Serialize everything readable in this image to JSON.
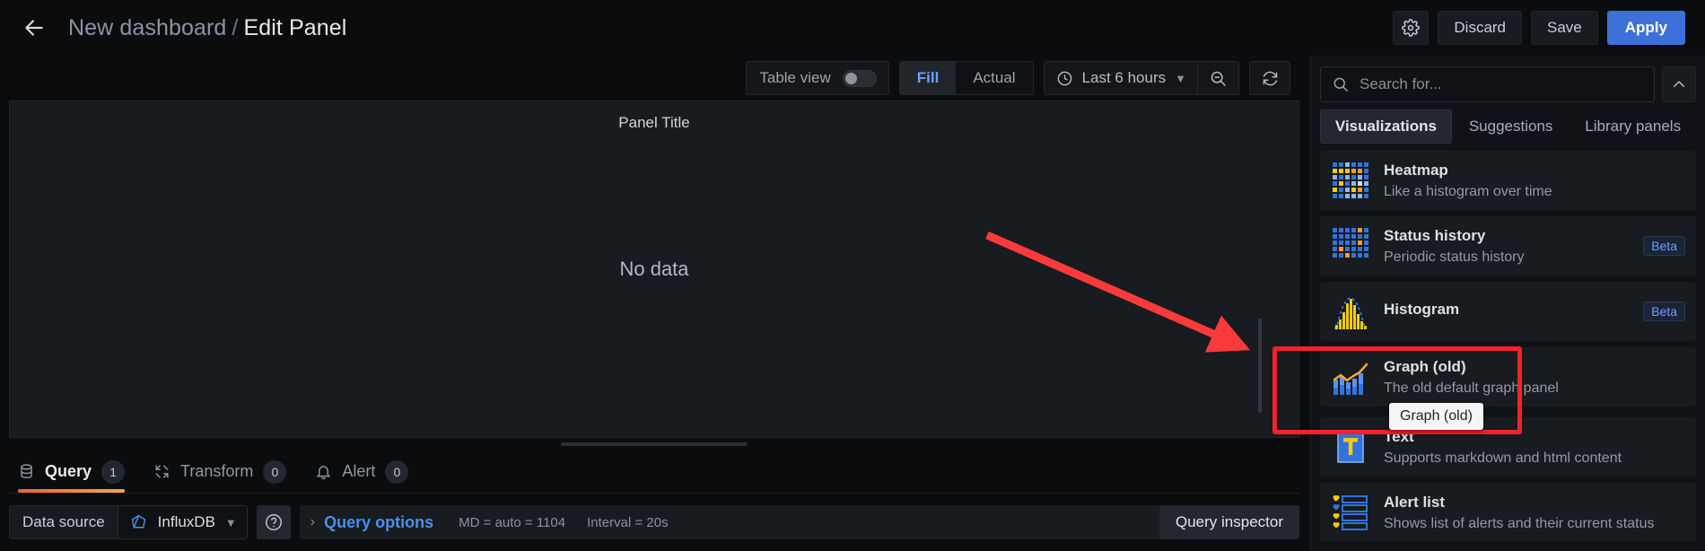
{
  "topbar": {
    "back_icon": "arrow-left-icon",
    "breadcrumb_dashboard": "New dashboard",
    "breadcrumb_separator": "/",
    "breadcrumb_current": "Edit Panel",
    "settings_icon": "gear-icon",
    "discard_label": "Discard",
    "save_label": "Save",
    "apply_label": "Apply",
    "apply_color": "#3d71d9"
  },
  "panel_toolbar": {
    "table_view_label": "Table view",
    "table_view_enabled": false,
    "fit_options": [
      "Fill",
      "Actual"
    ],
    "fit_selected": "Fill",
    "time_range": "Last 6 hours",
    "time_icon": "clock-icon",
    "time_chevron_icon": "chevron-down-icon",
    "zoom_out_icon": "zoom-out-icon",
    "refresh_icon": "refresh-icon"
  },
  "panel": {
    "title": "Panel Title",
    "no_data_text": "No data"
  },
  "query_tabs": [
    {
      "label": "Query",
      "badge": "1",
      "icon": "database-icon",
      "active": true
    },
    {
      "label": "Transform",
      "badge": "0",
      "icon": "transform-icon",
      "active": false
    },
    {
      "label": "Alert",
      "badge": "0",
      "icon": "bell-icon",
      "active": false
    }
  ],
  "query_row": {
    "data_source_label": "Data source",
    "data_source_value": "InfluxDB",
    "data_source_icon": "influxdb-icon",
    "data_source_chevron": "chevron-down-icon",
    "help_icon": "question-circle-icon",
    "expand_icon": "chevron-right-icon",
    "query_options_label": "Query options",
    "meta_md": "MD = auto = 1104",
    "meta_interval": "Interval = 20s",
    "query_inspector_label": "Query inspector"
  },
  "sidebar": {
    "search_placeholder": "Search for...",
    "search_value": "",
    "search_icon": "search-icon",
    "collapse_icon": "chevron-up-icon",
    "tabs": [
      {
        "label": "Visualizations",
        "active": true
      },
      {
        "label": "Suggestions",
        "active": false
      },
      {
        "label": "Library panels",
        "active": false
      }
    ],
    "items": [
      {
        "name": "Heatmap",
        "desc": "Like a histogram over time",
        "icon": "heatmap-icon",
        "badge": ""
      },
      {
        "name": "Status history",
        "desc": "Periodic status history",
        "icon": "status-history-icon",
        "badge": "Beta"
      },
      {
        "name": "Histogram",
        "desc": "",
        "icon": "histogram-icon",
        "badge": "Beta"
      },
      {
        "name": "Graph (old)",
        "desc": "The old default graph panel",
        "icon": "graph-old-icon",
        "badge": ""
      },
      {
        "name": "Text",
        "desc": "Supports markdown and html content",
        "icon": "text-icon",
        "badge": ""
      },
      {
        "name": "Alert list",
        "desc": "Shows list of alerts and their current status",
        "icon": "alert-list-icon",
        "badge": ""
      }
    ]
  },
  "annotations": {
    "tooltip_text": "Graph (old)",
    "highlight_color": "#f5222d",
    "arrow_color": "#fb3b3b"
  }
}
